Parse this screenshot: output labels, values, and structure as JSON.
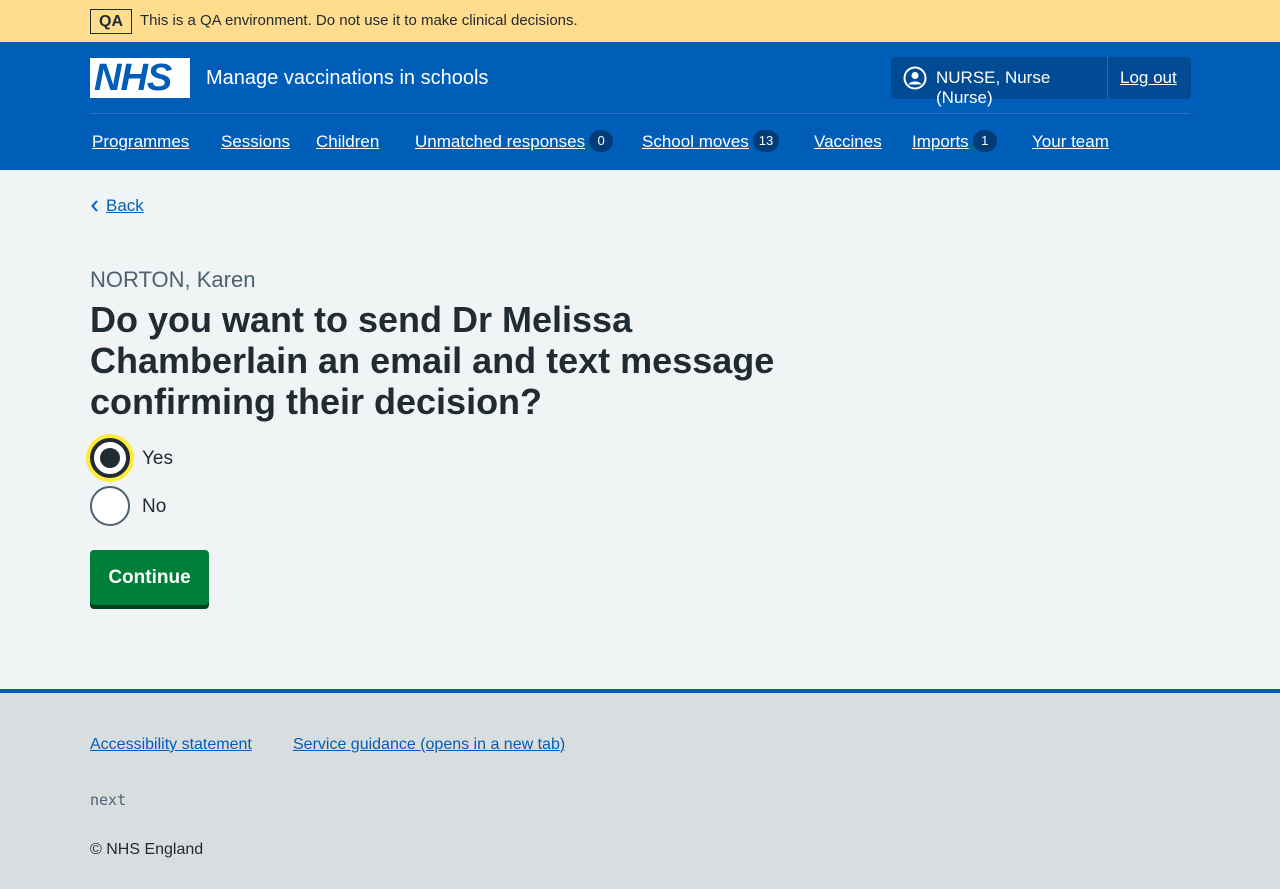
{
  "qa_banner": {
    "tag": "QA",
    "message": "This is a QA environment. Do not use it to make clinical decisions."
  },
  "header": {
    "logo_text": "NHS",
    "service_name": "Manage vaccinations in schools",
    "account": {
      "user_label": "NURSE, Nurse (Nurse)",
      "logout_label": "Log out"
    },
    "nav": [
      {
        "label": "Programmes"
      },
      {
        "label": "Sessions"
      },
      {
        "label": "Children"
      },
      {
        "label": "Unmatched responses",
        "badge": "0"
      },
      {
        "label": "School moves",
        "badge": "13"
      },
      {
        "label": "Vaccines"
      },
      {
        "label": "Imports",
        "badge": "1"
      },
      {
        "label": "Your team"
      }
    ]
  },
  "main": {
    "back_label": "Back",
    "caption": "NORTON, Karen",
    "heading": "Do you want to send Dr Melissa Chamberlain an email and text message confirming their decision?",
    "options": [
      {
        "label": "Yes",
        "checked": true
      },
      {
        "label": "No",
        "checked": false
      }
    ],
    "continue_label": "Continue"
  },
  "footer": {
    "links": [
      {
        "label": "Accessibility statement"
      },
      {
        "label": "Service guidance (opens in a new tab)"
      }
    ],
    "environment": "next",
    "copyright": "© NHS England"
  },
  "colors": {
    "nhs_blue": "#005eb8",
    "qa_banner": "#ffdc8e",
    "button_green": "#007f3b",
    "focus_yellow": "#ffeb3b"
  }
}
